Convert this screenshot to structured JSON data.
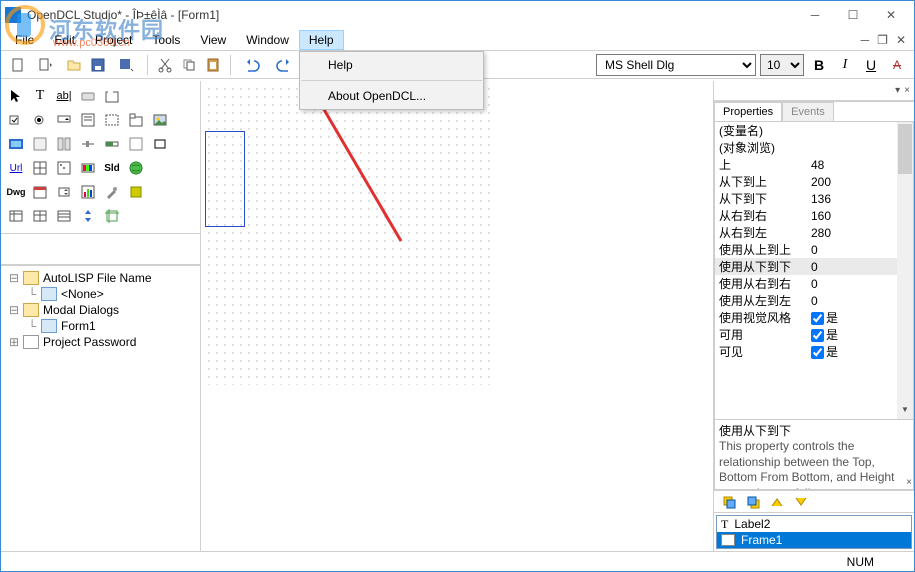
{
  "window": {
    "title": "OpenDCL Studio* - ÎÞ±êÌâ - [Form1]"
  },
  "menu": {
    "items": [
      "File",
      "Edit",
      "Project",
      "Tools",
      "View",
      "Window",
      "Help"
    ]
  },
  "help_dropdown": {
    "items": [
      "Help",
      "About OpenDCL..."
    ]
  },
  "font_toolbar": {
    "font": "MS Shell Dlg",
    "size": "10",
    "bold": "B",
    "italic": "I",
    "underline": "U",
    "strike": "A"
  },
  "watermark": {
    "text": "河东软件园",
    "url": "www.pc0359.cn"
  },
  "tree": {
    "n0": "AutoLISP File Name",
    "n0c": "<None>",
    "n1": "Modal Dialogs",
    "n1c": "Form1",
    "n2": "Project Password"
  },
  "tabs": {
    "prop": "Properties",
    "evt": "Events"
  },
  "props": {
    "r0": {
      "k": "(变量名)",
      "v": ""
    },
    "r1": {
      "k": "(对象浏览)",
      "v": ""
    },
    "r2": {
      "k": "上",
      "v": "48"
    },
    "r3": {
      "k": "从下到上",
      "v": "200"
    },
    "r4": {
      "k": "从下到下",
      "v": "136"
    },
    "r5": {
      "k": "从右到右",
      "v": "160"
    },
    "r6": {
      "k": "从右到左",
      "v": "280"
    },
    "r7": {
      "k": "使用从上到上",
      "v": "0"
    },
    "r8": {
      "k": "使用从下到下",
      "v": "0"
    },
    "r9": {
      "k": "使用从右到右",
      "v": "0"
    },
    "r10": {
      "k": "使用从左到左",
      "v": "0"
    },
    "r11": {
      "k": "使用视觉风格",
      "v": "是",
      "cb": true
    },
    "r12": {
      "k": "可用",
      "v": "是",
      "cb": true
    },
    "r13": {
      "k": "可见",
      "v": "是",
      "cb": true
    }
  },
  "help": {
    "title": "使用从下到下",
    "text": "This property controls the relationship between the Top, Bottom From Bottom, and Height properties, as follows:"
  },
  "zorder": {
    "i0": "Label2",
    "i1": "Frame1"
  },
  "status": {
    "num": "NUM"
  }
}
